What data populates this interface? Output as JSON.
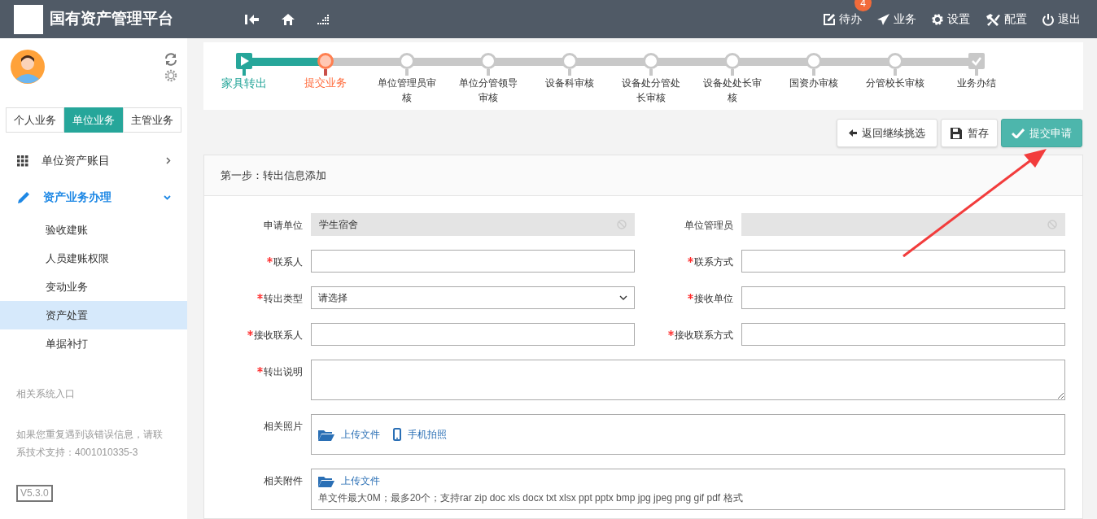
{
  "header": {
    "title": "国有资产管理平台",
    "nav": [
      {
        "label": "待办",
        "badge": "4"
      },
      {
        "label": "业务"
      },
      {
        "label": "设置"
      },
      {
        "label": "配置"
      },
      {
        "label": "退出"
      }
    ]
  },
  "sidebar": {
    "tabs": [
      {
        "label": "个人业务",
        "selected": false
      },
      {
        "label": "单位业务",
        "selected": true
      },
      {
        "label": "主管业务",
        "selected": false
      }
    ],
    "menu": [
      {
        "label": "单位资产账目",
        "expanded": false
      },
      {
        "label": "资产业务办理",
        "expanded": true,
        "children": [
          {
            "label": "验收建账",
            "selected": false
          },
          {
            "label": "人员建账权限",
            "selected": false
          },
          {
            "label": "变动业务",
            "selected": false
          },
          {
            "label": "资产处置",
            "selected": true
          },
          {
            "label": "单据补打",
            "selected": false
          }
        ]
      }
    ],
    "links_title": "相关系统入口",
    "help": "如果您重复遇到该错误信息，请联系技术支持：4001010335-3",
    "version": "V5.3.0"
  },
  "steps": [
    {
      "label": "家具转出",
      "kind": "start",
      "completed": true,
      "current": false
    },
    {
      "label": "提交业务",
      "kind": "step",
      "completed": false,
      "current": true
    },
    {
      "label": "单位管理员审核",
      "kind": "step",
      "completed": false,
      "current": false
    },
    {
      "label": "单位分管领导审核",
      "kind": "step",
      "completed": false,
      "current": false
    },
    {
      "label": "设备科审核",
      "kind": "step",
      "completed": false,
      "current": false
    },
    {
      "label": "设备处分管处长审核",
      "kind": "step",
      "completed": false,
      "current": false
    },
    {
      "label": "设备处处长审核",
      "kind": "step",
      "completed": false,
      "current": false
    },
    {
      "label": "国资办审核",
      "kind": "step",
      "completed": false,
      "current": false
    },
    {
      "label": "分管校长审核",
      "kind": "step",
      "completed": false,
      "current": false
    },
    {
      "label": "业务办结",
      "kind": "end",
      "completed": false,
      "current": false
    }
  ],
  "actions": [
    {
      "label": "返回继续挑选",
      "kind": "default"
    },
    {
      "label": "暂存",
      "kind": "default"
    },
    {
      "label": "提交申请",
      "kind": "primary"
    }
  ],
  "form": {
    "title": "第一步：转出信息添加",
    "rows": [
      [
        {
          "label": "申请单位",
          "required": false,
          "kind": "disabled",
          "value": "学生宿舍"
        },
        {
          "label": "单位管理员",
          "required": false,
          "kind": "disabled"
        }
      ],
      [
        {
          "label": "联系人",
          "required": true,
          "kind": "text"
        },
        {
          "label": "联系方式",
          "required": true,
          "kind": "text"
        }
      ],
      [
        {
          "label": "转出类型",
          "required": true,
          "kind": "select",
          "value": "请选择"
        },
        {
          "label": "接收单位",
          "required": true,
          "kind": "text"
        }
      ],
      [
        {
          "label": "接收联系人",
          "required": true,
          "kind": "text"
        },
        {
          "label": "接收联系方式",
          "required": true,
          "kind": "text"
        }
      ],
      [
        {
          "label": "转出说明",
          "required": true,
          "kind": "textarea"
        }
      ],
      [
        {
          "label": "相关照片",
          "required": false,
          "kind": "upload",
          "links": [
            "上传文件",
            "手机拍照"
          ]
        }
      ],
      [
        {
          "label": "相关附件",
          "required": false,
          "kind": "upload",
          "links": [
            "上传文件"
          ],
          "hint": "单文件最大0M；最多20个；支持rar zip doc xls docx txt xlsx ppt pptx bmp jpg jpeg png gif pdf 格式"
        }
      ]
    ]
  }
}
